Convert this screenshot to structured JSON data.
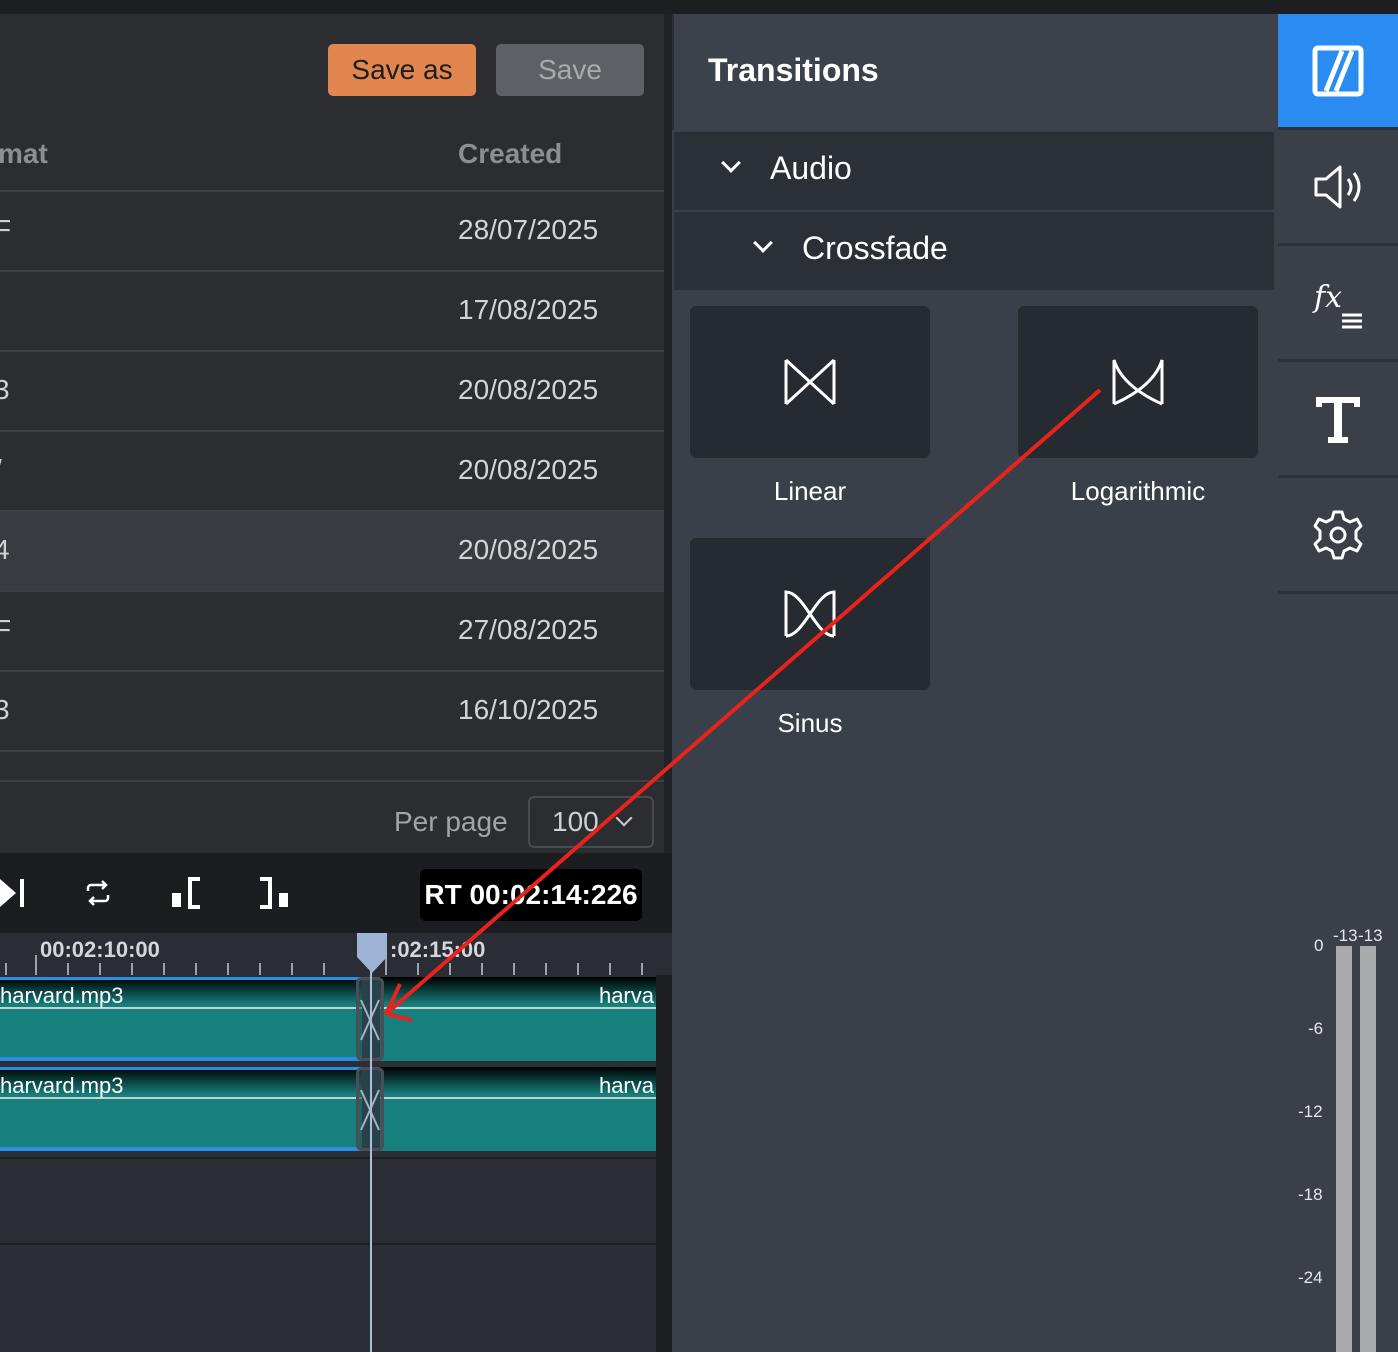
{
  "toolbar": {
    "save_as_label": "Save as",
    "save_label": "Save"
  },
  "table": {
    "columns": [
      "mat",
      "Created"
    ],
    "rows": [
      {
        "format": "F",
        "created": "28/07/2025"
      },
      {
        "format": "",
        "created": "17/08/2025"
      },
      {
        "format": "3",
        "created": "20/08/2025"
      },
      {
        "format": "/",
        "created": "20/08/2025"
      },
      {
        "format": "4",
        "created": "20/08/2025"
      },
      {
        "format": "F",
        "created": "27/08/2025"
      },
      {
        "format": "3",
        "created": "16/10/2025"
      }
    ],
    "selected_row": 4
  },
  "pagination": {
    "per_page_label": "Per page",
    "per_page_value": "100"
  },
  "transport": {
    "time_display": "RT 00:02:14:226"
  },
  "timeline": {
    "ruler_labels": [
      "00:02:10:00",
      ":02:15:00"
    ],
    "tracks": [
      {
        "clip_left_name": "harvard.mp3",
        "clip_right_name": "harva"
      },
      {
        "clip_left_name": "harvard.mp3",
        "clip_right_name": "harva"
      }
    ]
  },
  "transitions": {
    "title": "Transitions",
    "group": "Audio",
    "subgroup": "Crossfade",
    "items": [
      {
        "label": "Linear",
        "icon": "linear-crossfade-icon"
      },
      {
        "label": "Logarithmic",
        "icon": "logarithmic-crossfade-icon"
      },
      {
        "label": "Sinus",
        "icon": "sinus-crossfade-icon"
      }
    ]
  },
  "sidebar": {
    "items": [
      "transitions-icon",
      "audio-icon",
      "effects-icon",
      "text-icon",
      "settings-icon"
    ],
    "active": "transitions-icon",
    "accent_color": "#2a8cf0"
  },
  "meter": {
    "peak_labels": [
      "-13",
      "-13"
    ],
    "scale": [
      "0",
      "-6",
      "-12",
      "-18",
      "-24"
    ]
  },
  "colors": {
    "save_as": "#e0864e",
    "clip": "#16807f",
    "annotation_arrow": "#e8231c"
  }
}
